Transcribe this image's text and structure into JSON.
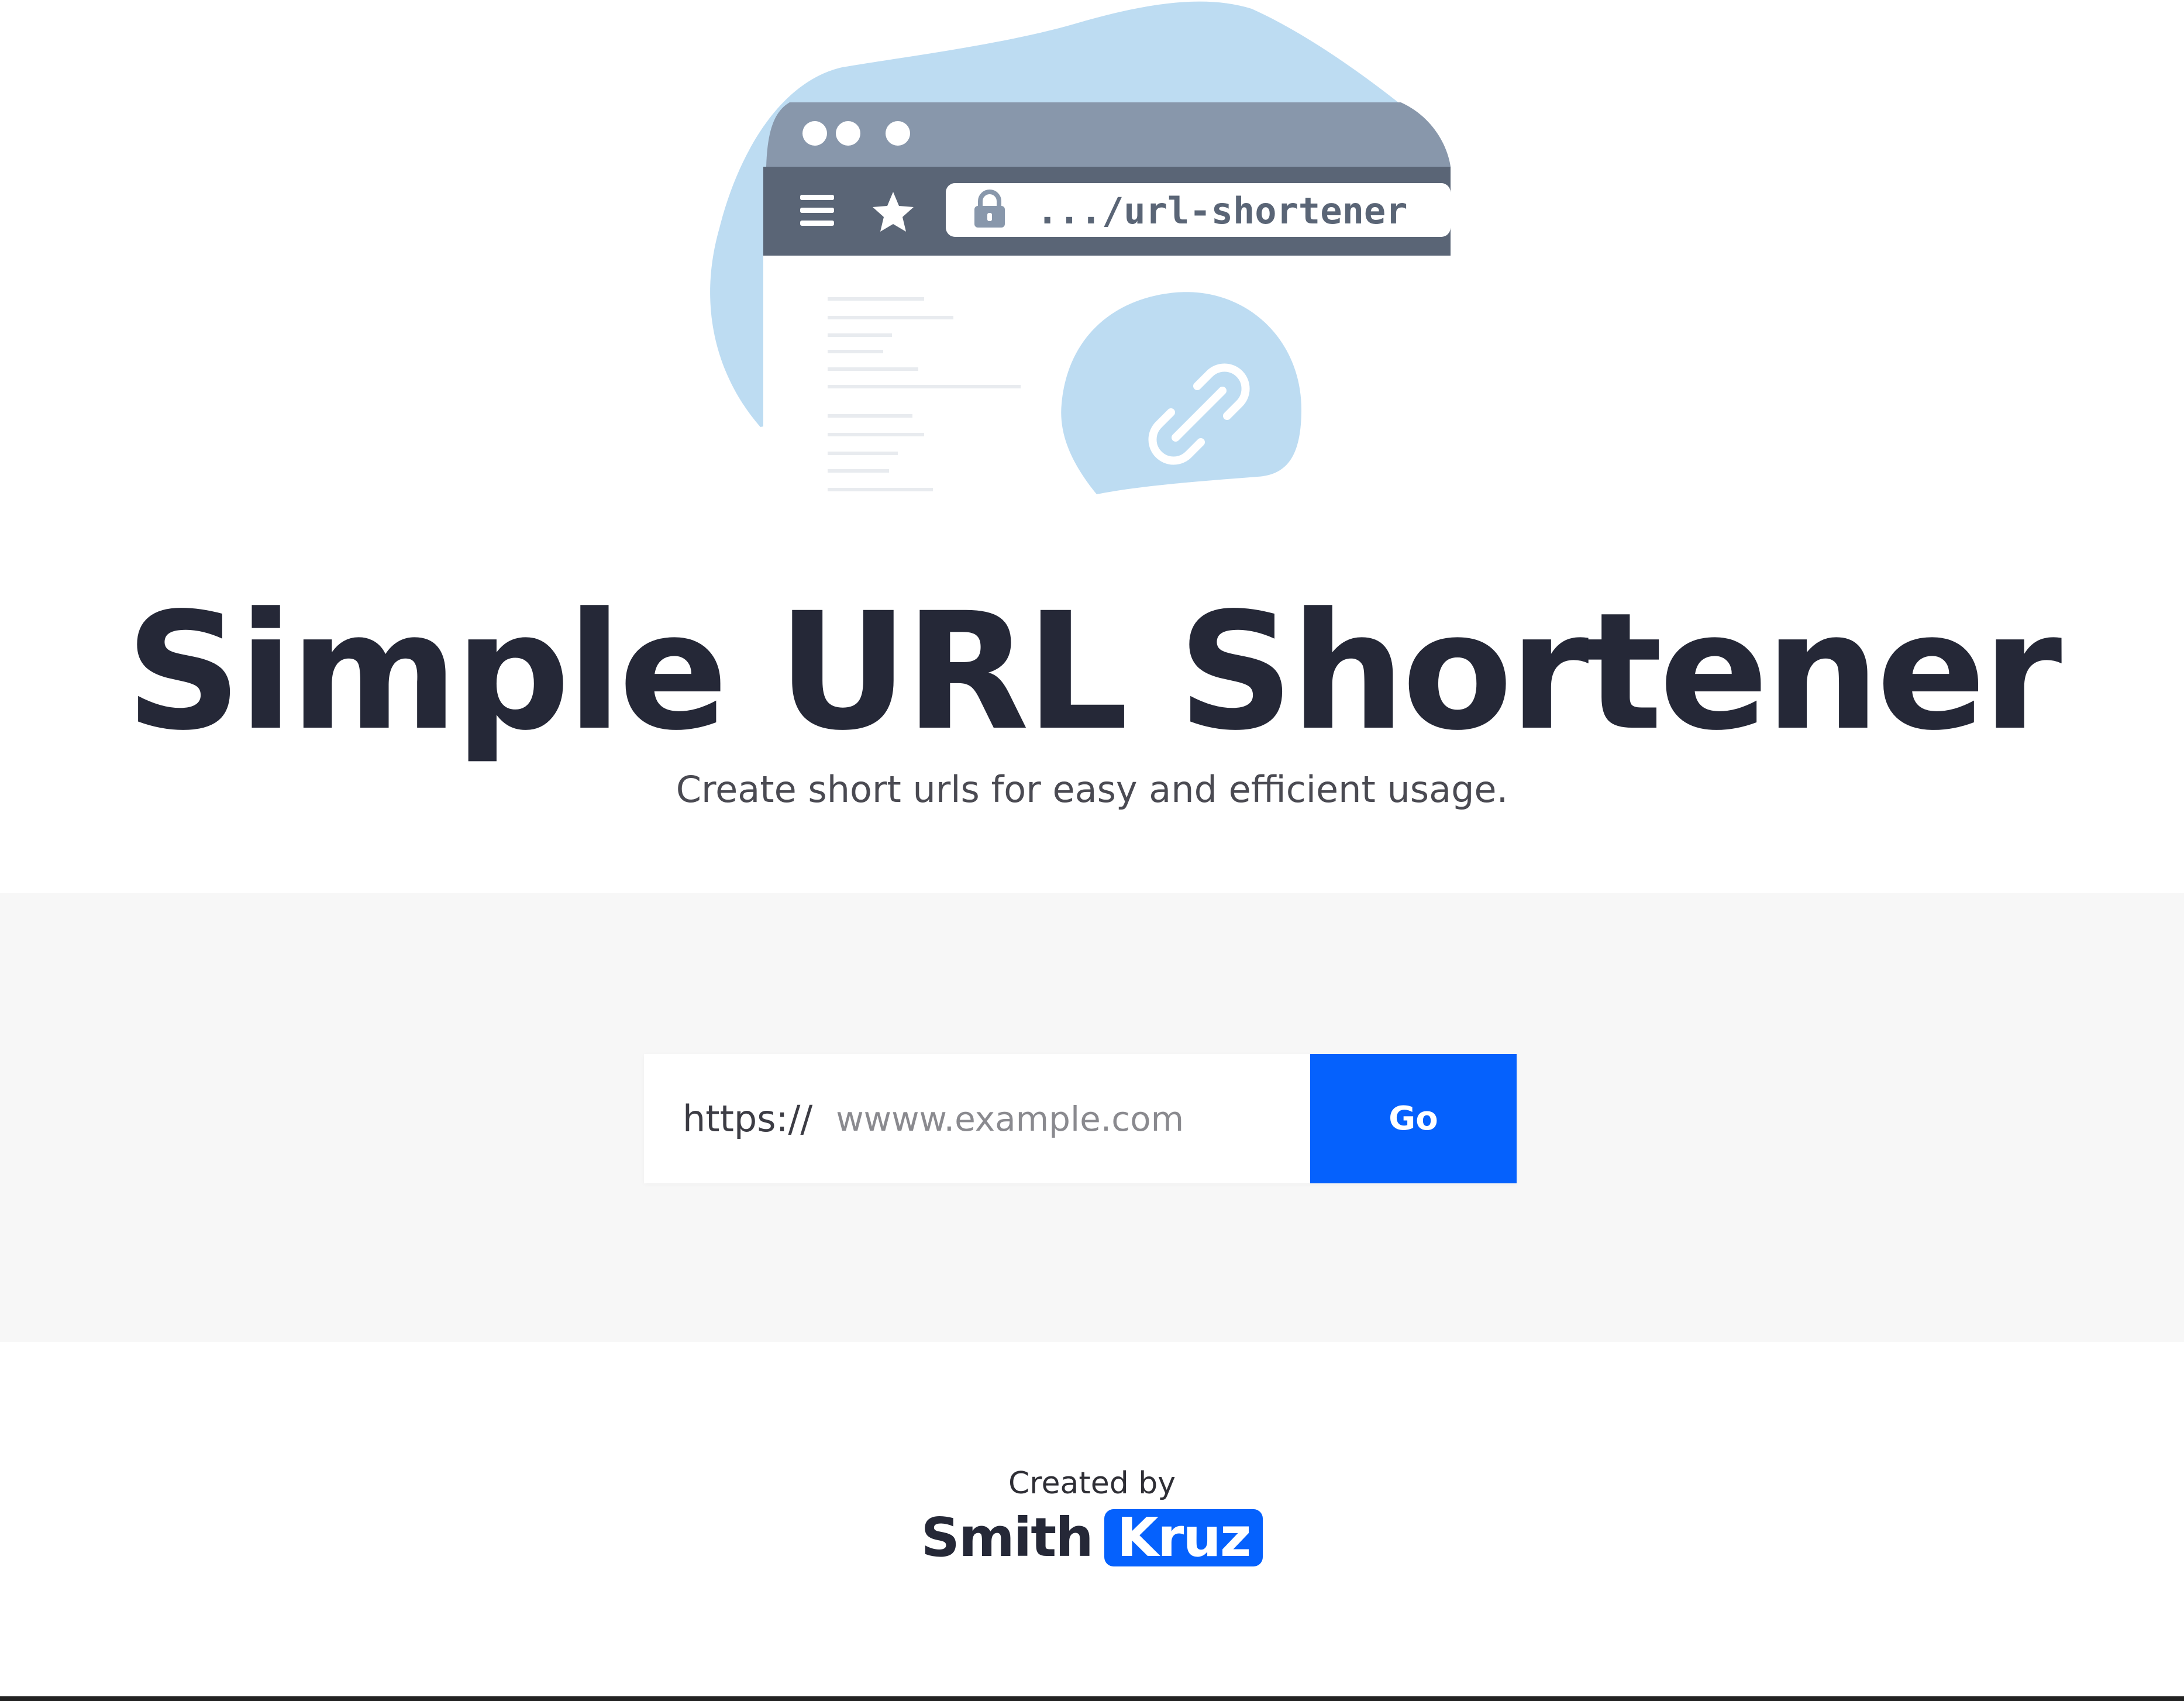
{
  "hero": {
    "address_bar_text": ".../url-shortener",
    "icon_names": [
      "menu-icon",
      "star-icon",
      "lock-icon",
      "link-icon"
    ]
  },
  "header": {
    "title": "Simple URL Shortener",
    "subtitle": "Create short urls for easy and efficient usage."
  },
  "form": {
    "prefix": "https://",
    "placeholder": "wwww.example.com",
    "value": "",
    "submit_label": "Go"
  },
  "footer": {
    "credit_label": "Created by",
    "author_first": "Smith",
    "author_last": "Kruz"
  },
  "colors": {
    "accent": "#0561fd",
    "title": "#252837",
    "band_background": "#f7f7f7",
    "illustration_blob": "#bddcf2"
  }
}
